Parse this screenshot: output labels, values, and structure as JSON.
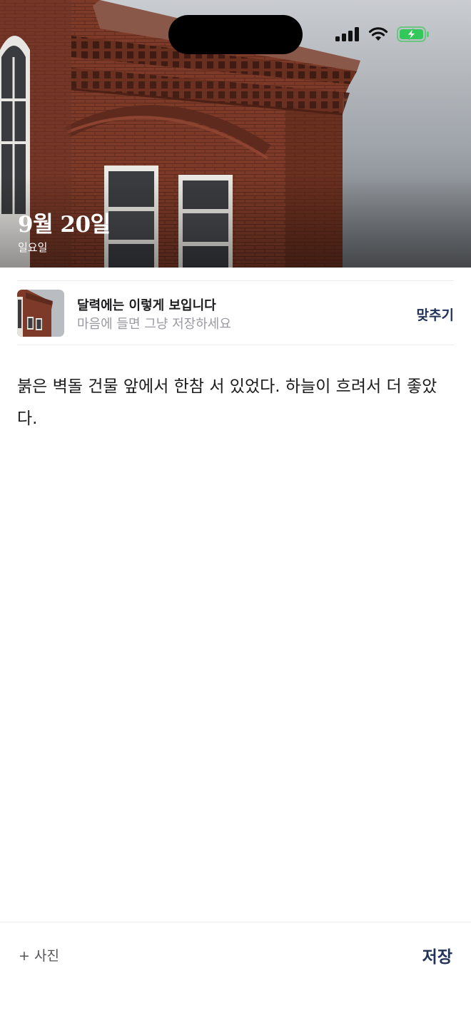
{
  "hero": {
    "photo_alt": "red-brick-building-photo",
    "date": "9월 20일",
    "weekday": "일요일"
  },
  "status_bar": {
    "icons": [
      "cellular-signal-icon",
      "wifi-icon",
      "battery-charging-icon"
    ],
    "battery_color": "#34c759"
  },
  "preview": {
    "title": "달력에는 이렇게 보입니다",
    "subtitle": "마음에 들면 그냥 저장하세요",
    "fit_label": "맞추기"
  },
  "entry": {
    "text": "붉은 벽돌 건물 앞에서 한참 서 있었다. 하늘이 흐려서 더 좋았다."
  },
  "bottom_bar": {
    "add_photo_label": "+ 사진",
    "save_label": "저장"
  },
  "colors": {
    "accent": "#22335a",
    "subtle_text": "#9a9aa0",
    "divider": "#ececec"
  }
}
